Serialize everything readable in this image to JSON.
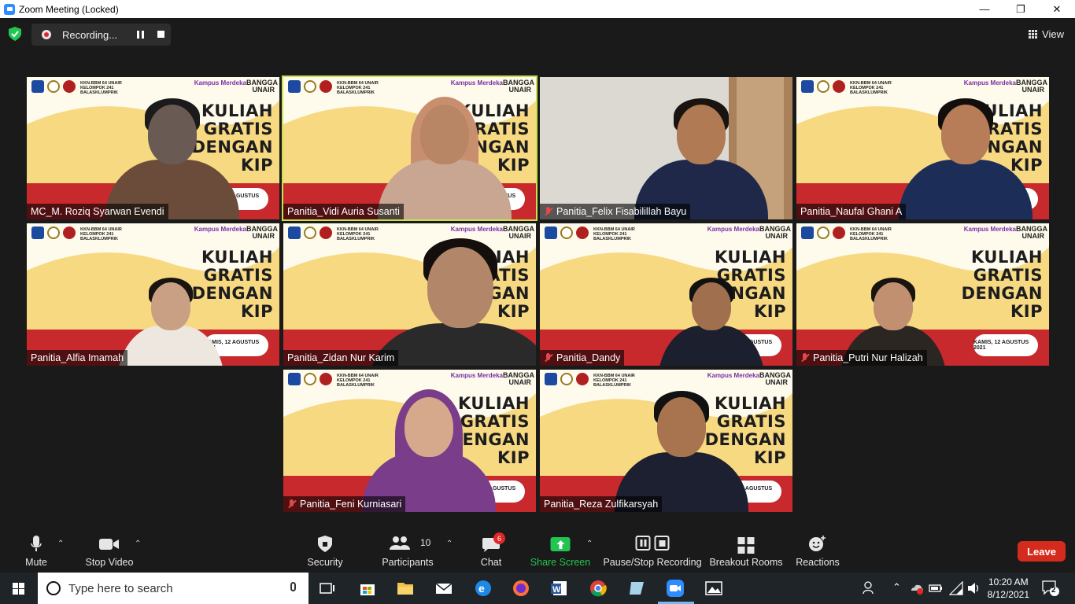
{
  "window": {
    "title": "Zoom Meeting (Locked)"
  },
  "recording": {
    "label": "Recording..."
  },
  "view": {
    "label": "View"
  },
  "banner": {
    "kkn": "KKN-BBM 64 UNAIR KELOMPOK 241 BALASKLUMPRIK",
    "bangga": "BANGGA UNAIR",
    "kampus": "Kampus Merdeka",
    "headline_1": "KULIAH",
    "headline_2": "GRATIS",
    "headline_3": "DENGAN",
    "headline_4": "KIP",
    "date": "KAMIS, 12 AGUSTUS 2021"
  },
  "participants": [
    {
      "name": "MC_M. Roziq Syarwan Evendi",
      "muted": false
    },
    {
      "name": "Panitia_Vidi Auria Susanti",
      "muted": false
    },
    {
      "name": "Panitia_Felix Fisabilillah Bayu",
      "muted": true
    },
    {
      "name": "Panitia_Naufal Ghani A",
      "muted": false
    },
    {
      "name": "Panitia_Alfia Imamah",
      "muted": false
    },
    {
      "name": "Panitia_Zidan Nur Karim",
      "muted": false
    },
    {
      "name": "Panitia_Dandy",
      "muted": true
    },
    {
      "name": "Panitia_Putri Nur Halizah",
      "muted": true
    },
    {
      "name": "Panitia_Feni Kurniasari",
      "muted": true
    },
    {
      "name": "Panitia_Reza Zulfikarsyah",
      "muted": false
    }
  ],
  "toolbar": {
    "mute": "Mute",
    "stop_video": "Stop Video",
    "security": "Security",
    "participants": "Participants",
    "participants_count": "10",
    "chat": "Chat",
    "chat_badge": "6",
    "share_screen": "Share Screen",
    "pause_stop_recording": "Pause/Stop Recording",
    "breakout_rooms": "Breakout Rooms",
    "reactions": "Reactions",
    "leave": "Leave"
  },
  "taskbar": {
    "search_placeholder": "Type here to search",
    "time": "10:20 AM",
    "date": "8/12/2021",
    "notifications": "2"
  },
  "colors": {
    "share_green": "#23c552",
    "leave_red": "#d52b1e",
    "active_speaker": "#c7e34a",
    "banner_yellow": "#f7d982",
    "banner_red": "#c8292d"
  }
}
